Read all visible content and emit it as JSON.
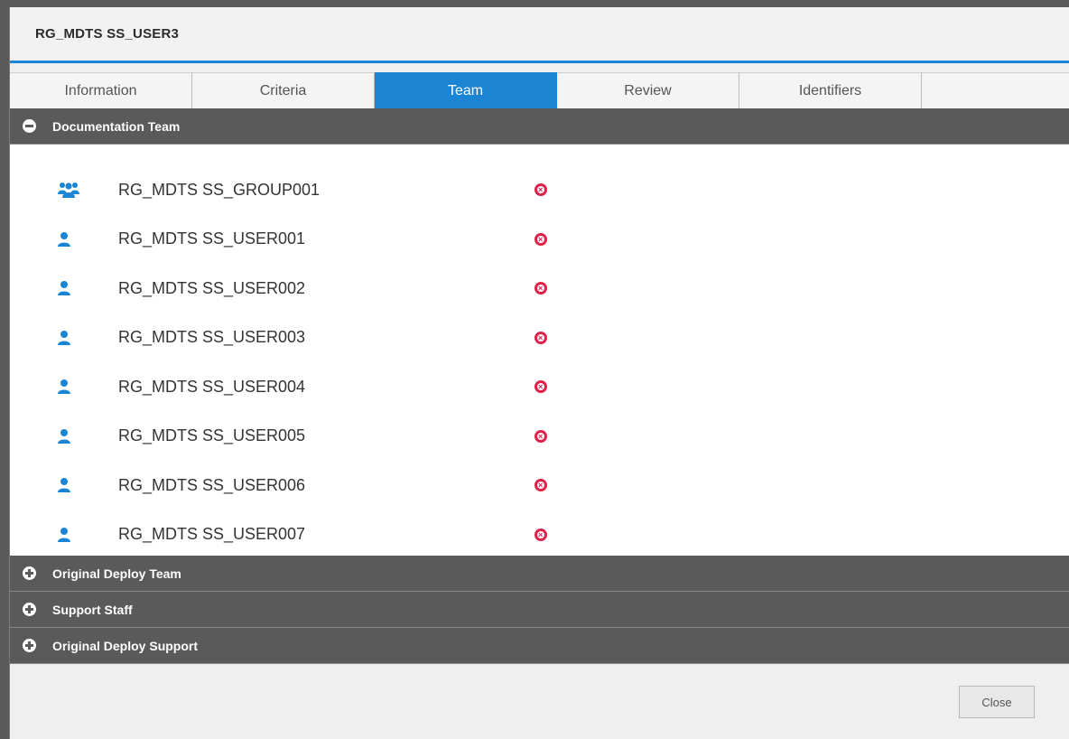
{
  "dialog": {
    "title": "RG_MDTS SS_USER3"
  },
  "tabs": [
    {
      "label": "Information",
      "active": false
    },
    {
      "label": "Criteria",
      "active": false
    },
    {
      "label": "Team",
      "active": true
    },
    {
      "label": "Review",
      "active": false
    },
    {
      "label": "Identifiers",
      "active": false
    }
  ],
  "sections": {
    "documentation": {
      "label": "Documentation Team",
      "expanded": true,
      "icon": "minus-circle-icon"
    },
    "original_deploy": {
      "label": "Original Deploy Team",
      "expanded": false,
      "icon": "plus-circle-icon"
    },
    "support_staff": {
      "label": "Support Staff",
      "expanded": false,
      "icon": "plus-circle-icon"
    },
    "original_support": {
      "label": "Original Deploy Support",
      "expanded": false,
      "icon": "plus-circle-icon"
    }
  },
  "members": [
    {
      "name": "RG_MDTS SS_GROUP001",
      "icon": "group-icon"
    },
    {
      "name": "RG_MDTS SS_USER001",
      "icon": "user-icon"
    },
    {
      "name": "RG_MDTS SS_USER002",
      "icon": "user-icon"
    },
    {
      "name": "RG_MDTS SS_USER003",
      "icon": "user-icon"
    },
    {
      "name": "RG_MDTS SS_USER004",
      "icon": "user-icon"
    },
    {
      "name": "RG_MDTS SS_USER005",
      "icon": "user-icon"
    },
    {
      "name": "RG_MDTS SS_USER006",
      "icon": "user-icon"
    },
    {
      "name": "RG_MDTS SS_USER007",
      "icon": "user-icon"
    }
  ],
  "footer": {
    "close_label": "Close"
  },
  "colors": {
    "accent": "#1b84d3",
    "header_bg": "#5a5a5a",
    "remove": "#e0224a"
  }
}
